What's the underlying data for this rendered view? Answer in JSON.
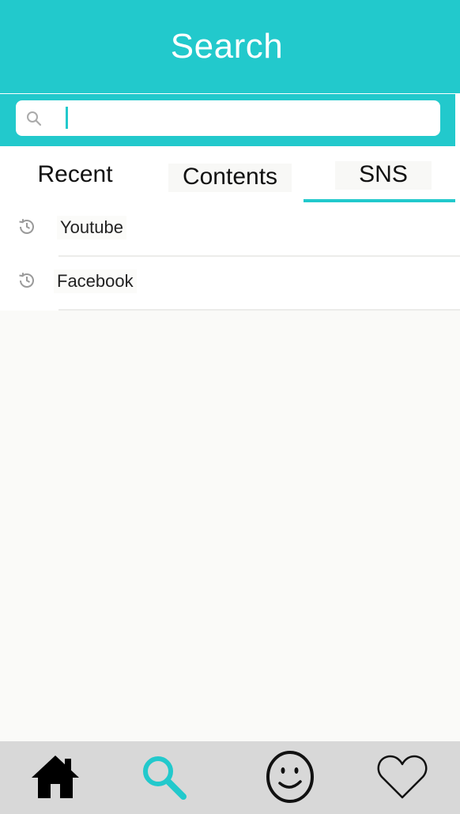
{
  "header": {
    "title": "Search"
  },
  "search": {
    "placeholder": "",
    "value": ""
  },
  "tabs": [
    {
      "label": "Recent",
      "active": false
    },
    {
      "label": "Contents",
      "active": false
    },
    {
      "label": "SNS",
      "active": true
    }
  ],
  "history": [
    {
      "label": "Youtube",
      "icon": "history-icon"
    },
    {
      "label": "Facebook",
      "icon": "history-icon"
    }
  ],
  "bottom_nav": [
    {
      "icon": "home-icon",
      "active": false
    },
    {
      "icon": "search-icon",
      "active": true
    },
    {
      "icon": "smiley-icon",
      "active": false
    },
    {
      "icon": "heart-icon",
      "active": false
    }
  ],
  "colors": {
    "accent": "#22c9cc",
    "nav_bg": "#d8d8d8",
    "icon_dark": "#000000"
  }
}
